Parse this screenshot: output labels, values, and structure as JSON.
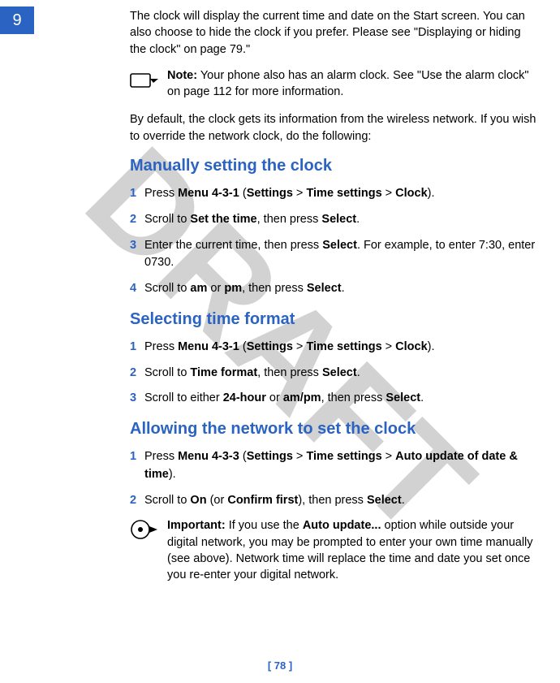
{
  "chapter": "9",
  "watermark": "DRAFT",
  "intro": "The clock will display the current time and date on the Start screen. You can also choose to hide the clock if you prefer. Please see \"Displaying or hiding the clock\" on page 79.\"",
  "note": {
    "label": "Note:",
    "body": "Your phone also has an alarm clock. See \"Use the alarm clock\" on page 112 for more information."
  },
  "default_text": "By default, the clock gets its information from the wireless network. If you wish to override the network clock, do the following:",
  "section1": {
    "heading": "Manually setting the clock",
    "steps": [
      {
        "n": "1",
        "pre": "Press ",
        "b1": "Menu 4-3-1",
        "mid1": " (",
        "b2": "Settings",
        "mid2": " > ",
        "b3": "Time settings",
        "mid3": " > ",
        "b4": "Clock",
        "post": ")."
      },
      {
        "n": "2",
        "pre": "Scroll to ",
        "b1": "Set the time",
        "mid1": ", then press ",
        "b2": "Select",
        "post": "."
      },
      {
        "n": "3",
        "pre": "Enter the current time, then press ",
        "b1": "Select",
        "post": ". For example, to enter 7:30, enter 0730."
      },
      {
        "n": "4",
        "pre": "Scroll to ",
        "b1": "am",
        "mid1": " or ",
        "b2": "pm",
        "mid2": ", then press ",
        "b3": "Select",
        "post": "."
      }
    ]
  },
  "section2": {
    "heading": "Selecting time format",
    "steps": [
      {
        "n": "1",
        "pre": "Press ",
        "b1": "Menu 4-3-1",
        "mid1": " (",
        "b2": "Settings",
        "mid2": " > ",
        "b3": "Time settings",
        "mid3": " > ",
        "b4": "Clock",
        "post": ")."
      },
      {
        "n": "2",
        "pre": "Scroll to ",
        "b1": "Time format",
        "mid1": ", then press ",
        "b2": "Select",
        "post": "."
      },
      {
        "n": "3",
        "pre": "Scroll to either ",
        "b1": "24-hour",
        "mid1": " or ",
        "b2": "am/pm",
        "mid2": ", then press ",
        "b3": "Select",
        "post": "."
      }
    ]
  },
  "section3": {
    "heading": "Allowing the network to set the clock",
    "steps": [
      {
        "n": "1",
        "pre": "Press ",
        "b1": "Menu 4-3-3",
        "mid1": " (",
        "b2": "Settings",
        "mid2": " > ",
        "b3": "Time settings",
        "mid3": " > ",
        "b4": "Auto update of date & time",
        "post": ")."
      },
      {
        "n": "2",
        "pre": "Scroll to ",
        "b1": "On",
        "mid1": " (or ",
        "b2": "Confirm first",
        "mid2": "), then press ",
        "b3": "Select",
        "post": "."
      }
    ]
  },
  "important": {
    "label": "Important:",
    "b1_pre": " If you use the ",
    "b1": "Auto update...",
    "body1": " option while outside your digital network, you may be prompted to enter your own time manually (",
    "see": "see above",
    "body2": "). Network time will replace the time and date you set once you re-enter your digital network."
  },
  "page_number": "[ 78 ]"
}
